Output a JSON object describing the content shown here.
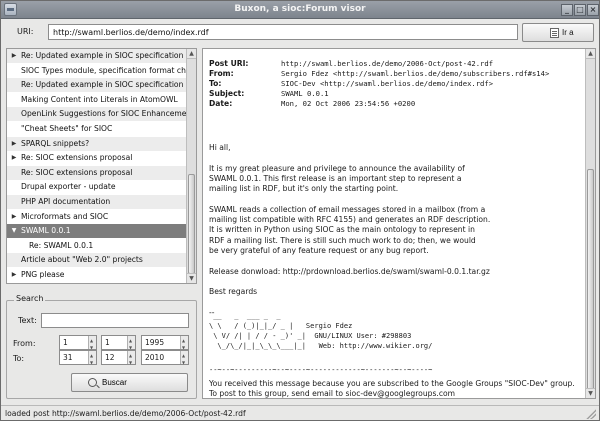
{
  "window": {
    "title": "Buxon, a sioc:Forum visor"
  },
  "uri_bar": {
    "label": "URI:",
    "value": "http://swaml.berlios.de/demo/index.rdf",
    "go_label": "Ir a"
  },
  "threads": [
    {
      "label": "Re: Updated example in SIOC specification",
      "expander": "▶",
      "style": "alt",
      "child": false
    },
    {
      "label": "SIOC Types module, specification format cha",
      "expander": "",
      "style": "",
      "child": false
    },
    {
      "label": "Re: Updated example in SIOC specification",
      "expander": "",
      "style": "alt",
      "child": false
    },
    {
      "label": "Making Content into Literals in AtomOWL",
      "expander": "",
      "style": "",
      "child": false
    },
    {
      "label": "OpenLink Suggestions for SIOC Enhancemer",
      "expander": "",
      "style": "alt",
      "child": false
    },
    {
      "label": "\"Cheat Sheets\" for SIOC",
      "expander": "",
      "style": "",
      "child": false
    },
    {
      "label": "SPARQL snippets?",
      "expander": "▶",
      "style": "alt",
      "child": false
    },
    {
      "label": "Re: SIOC extensions proposal",
      "expander": "▶",
      "style": "",
      "child": false
    },
    {
      "label": "Re: SIOC extensions proposal",
      "expander": "",
      "style": "alt",
      "child": false
    },
    {
      "label": "Drupal exporter - update",
      "expander": "",
      "style": "",
      "child": false
    },
    {
      "label": "PHP API documentation",
      "expander": "",
      "style": "alt",
      "child": false
    },
    {
      "label": "Microformats and SIOC",
      "expander": "▶",
      "style": "",
      "child": false
    },
    {
      "label": "SWAML 0.0.1",
      "expander": "▼",
      "style": "sel",
      "child": false
    },
    {
      "label": "Re: SWAML 0.0.1",
      "expander": "",
      "style": "",
      "child": true
    },
    {
      "label": "Article about \"Web 2.0\" projects",
      "expander": "",
      "style": "alt",
      "child": false
    },
    {
      "label": "PNG please",
      "expander": "▶",
      "style": "",
      "child": false
    }
  ],
  "search": {
    "legend": "Search",
    "text_label": "Text:",
    "text_value": "",
    "from_label": "From:",
    "to_label": "To:",
    "from": {
      "day": "1",
      "month": "1",
      "year": "1995"
    },
    "to": {
      "day": "31",
      "month": "12",
      "year": "2010"
    },
    "button_label": "Buscar"
  },
  "message": {
    "headers": [
      {
        "key": "Post URI:",
        "value": "http://swaml.berlios.de/demo/2006-Oct/post-42.rdf"
      },
      {
        "key": "From:",
        "value": "Sergio Fdez <http://swaml.berlios.de/demo/subscribers.rdf#s14>"
      },
      {
        "key": "To:",
        "value": "SIOC-Dev <http://swaml.berlios.de/demo/index.rdf>"
      },
      {
        "key": "Subject:",
        "value": "SWAML 0.0.1"
      },
      {
        "key": "Date:",
        "value": "Mon, 02 Oct 2006 23:54:56 +0200"
      }
    ],
    "body_lines": [
      "Hi all,",
      "",
      "It is my great pleasure and privilege to announce the availability of",
      "SWAML 0.0.1. This first release is an important step to represent a",
      "mailing list in RDF, but it's only the starting point.",
      "",
      "SWAML reads a collection of email messages stored in a mailbox (from a",
      "mailing list compatible with RFC 4155) and generates an RDF description.",
      "It is written in Python using SIOC as the main ontology to represent in",
      "RDF a mailing list. There is still such much work to do; then, we would",
      "be very grateful of any feature request or any bug report.",
      "",
      "Release donwload: http://prdownload.berlios.de/swaml/swaml-0.0.1.tar.gz",
      "",
      "Best regards",
      "",
      "--"
    ],
    "signature": [
      " __   _  ___ _  _",
      "\\ \\   / (_)|_|_/ _ |   Sergio Fdez",
      " \\ V/ /| | / / - _)' _|  GNU/LINUX User: #298803",
      "  \\_/\\_/|_|_\\_\\_\\___|_|   Web: http://www.wikier.org/"
    ],
    "separator": "--~--~---------~--~----~------------~-------~--~----~",
    "footer_lines": [
      "You received this message because you are subscribed to the Google Groups \"SIOC-Dev\" group.",
      "To post to this group, send email to sioc-dev@googlegroups.com"
    ]
  },
  "status": {
    "text": "loaded post http://swaml.berlios.de/demo/2006-Oct/post-42.rdf"
  }
}
